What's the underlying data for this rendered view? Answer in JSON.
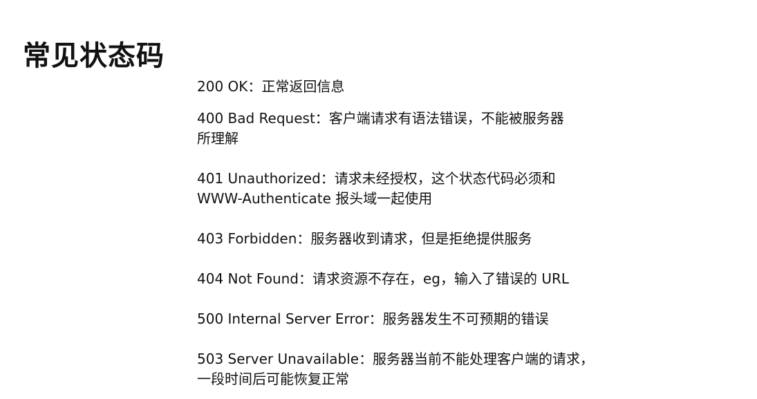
{
  "title": "常见状态码",
  "status_codes": [
    {
      "lines": [
        "200 OK：正常返回信息"
      ]
    },
    {
      "lines": [
        "400 Bad Request：客户端请求有语法错误，不能被服务器",
        "所理解"
      ]
    },
    {
      "lines": [
        "401 Unauthorized：请求未经授权，这个状态代码必须和",
        "WWW-Authenticate 报头域一起使用"
      ]
    },
    {
      "lines": [
        "403 Forbidden：服务器收到请求，但是拒绝提供服务"
      ]
    },
    {
      "lines": [
        "404 Not Found：请求资源不存在，eg，输入了错误的 URL"
      ]
    },
    {
      "lines": [
        "500 Internal Server Error：服务器发生不可预期的错误"
      ]
    },
    {
      "lines": [
        "503 Server Unavailable：服务器当前不能处理客户端的请求，",
        "一段时间后可能恢复正常"
      ]
    }
  ]
}
